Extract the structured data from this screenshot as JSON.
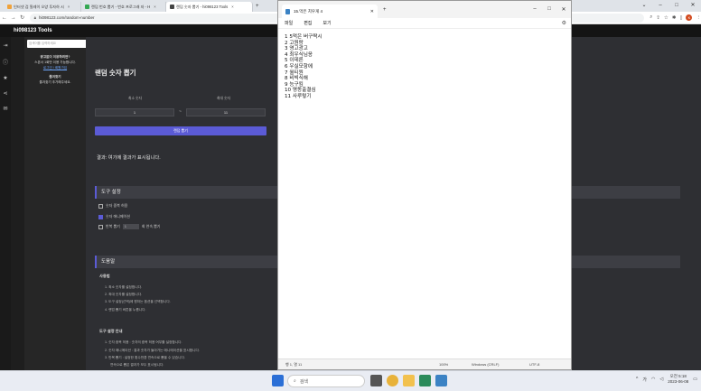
{
  "browser": {
    "tabs": [
      {
        "label": "인터넷 검 릴레이 오양 투자하 시",
        "color": "#f0a23b"
      },
      {
        "label": "랜덤 번호 뽑기 - 번호 프로그래 자 - H",
        "color": "#35a853"
      },
      {
        "label": "랜덤 숫자 뽑기 - hi098123 Tools",
        "color": "#444444"
      }
    ],
    "url": "hi098123.com/random-number",
    "avatar_letter": "K"
  },
  "site": {
    "brand": "hi098123 Tools",
    "sidebar": {
      "search_placeholder": "검색어를 입력하세요",
      "notice_title": "광고없이 이용하려면?",
      "notice_body": "스폰서 1회만 이용 가능합니다.",
      "notice_link": "로그인 / 회원가입",
      "favorite_title": "즐겨찾기",
      "favorite_body": "즐겨찾기 추가해주세요."
    },
    "title": "랜덤 숫자 뽑기",
    "min_label": "최소 숫자",
    "max_label": "최대 숫자",
    "min_value": "1",
    "max_value": "11",
    "range_sep": "~",
    "generate_button": "랜덤 뽑기",
    "result": "결과: 여기에 결과가 표시됩니다.",
    "settings": {
      "heading": "도구 설정",
      "options": [
        {
          "label": "숫자 중복 허용",
          "checked": false
        },
        {
          "label": "숫자 애니메이션",
          "checked": true
        },
        {
          "label": "반복 뽑기",
          "checked": false
        }
      ],
      "repeat_count": "1",
      "repeat_suffix": "회 연속 뽑기"
    },
    "help": {
      "heading": "도움말",
      "usage_title": "사용법",
      "usage": [
        "1. 최소 숫자를 설정합니다.",
        "2. 최대 숫자를 설정합니다.",
        "3. 도구 설정(선택)에 원하는 옵션을 선택합니다.",
        "4. 랜덤 뽑기 버튼을 누릅니다."
      ],
      "settings_title": "도구 설정 안내",
      "settings_lines": [
        "1. 숫자 중복 허용 : 숫자의 중복 허용 여부를 설정합니다.",
        "2. 숫자 애니메이션 : 결과 숫자가 돌아가는 애니메이션을 표시합니다.",
        "3. 반복 뽑기 : 설정한 횟수만큼 연속으로 뽑을 수 있습니다.",
        "연속으로 뽑은 결과가 모두 표시됩니다."
      ]
    }
  },
  "notepad": {
    "tab_title": "15.먹은 치우게 4",
    "menu": [
      "파일",
      "편집",
      "보기"
    ],
    "lines": [
      "1 5먹은 버구짝시",
      "2 고원랑",
      "3 영고광고",
      "4 최우식님응",
      "5 이데른",
      "6 우실모항에",
      "7 월티원",
      "8 비빅식해",
      "9 능구킴",
      "10 명동출결심",
      "11 사루렇기"
    ],
    "status": {
      "position": "행 1, 열 11",
      "zoom": "100%",
      "line_ending": "Windows (CRLF)",
      "encoding": "UTF-8"
    }
  },
  "taskbar": {
    "search": "검색",
    "lang": "가",
    "time": "오전 5:18",
    "date": "2023-06-08"
  }
}
